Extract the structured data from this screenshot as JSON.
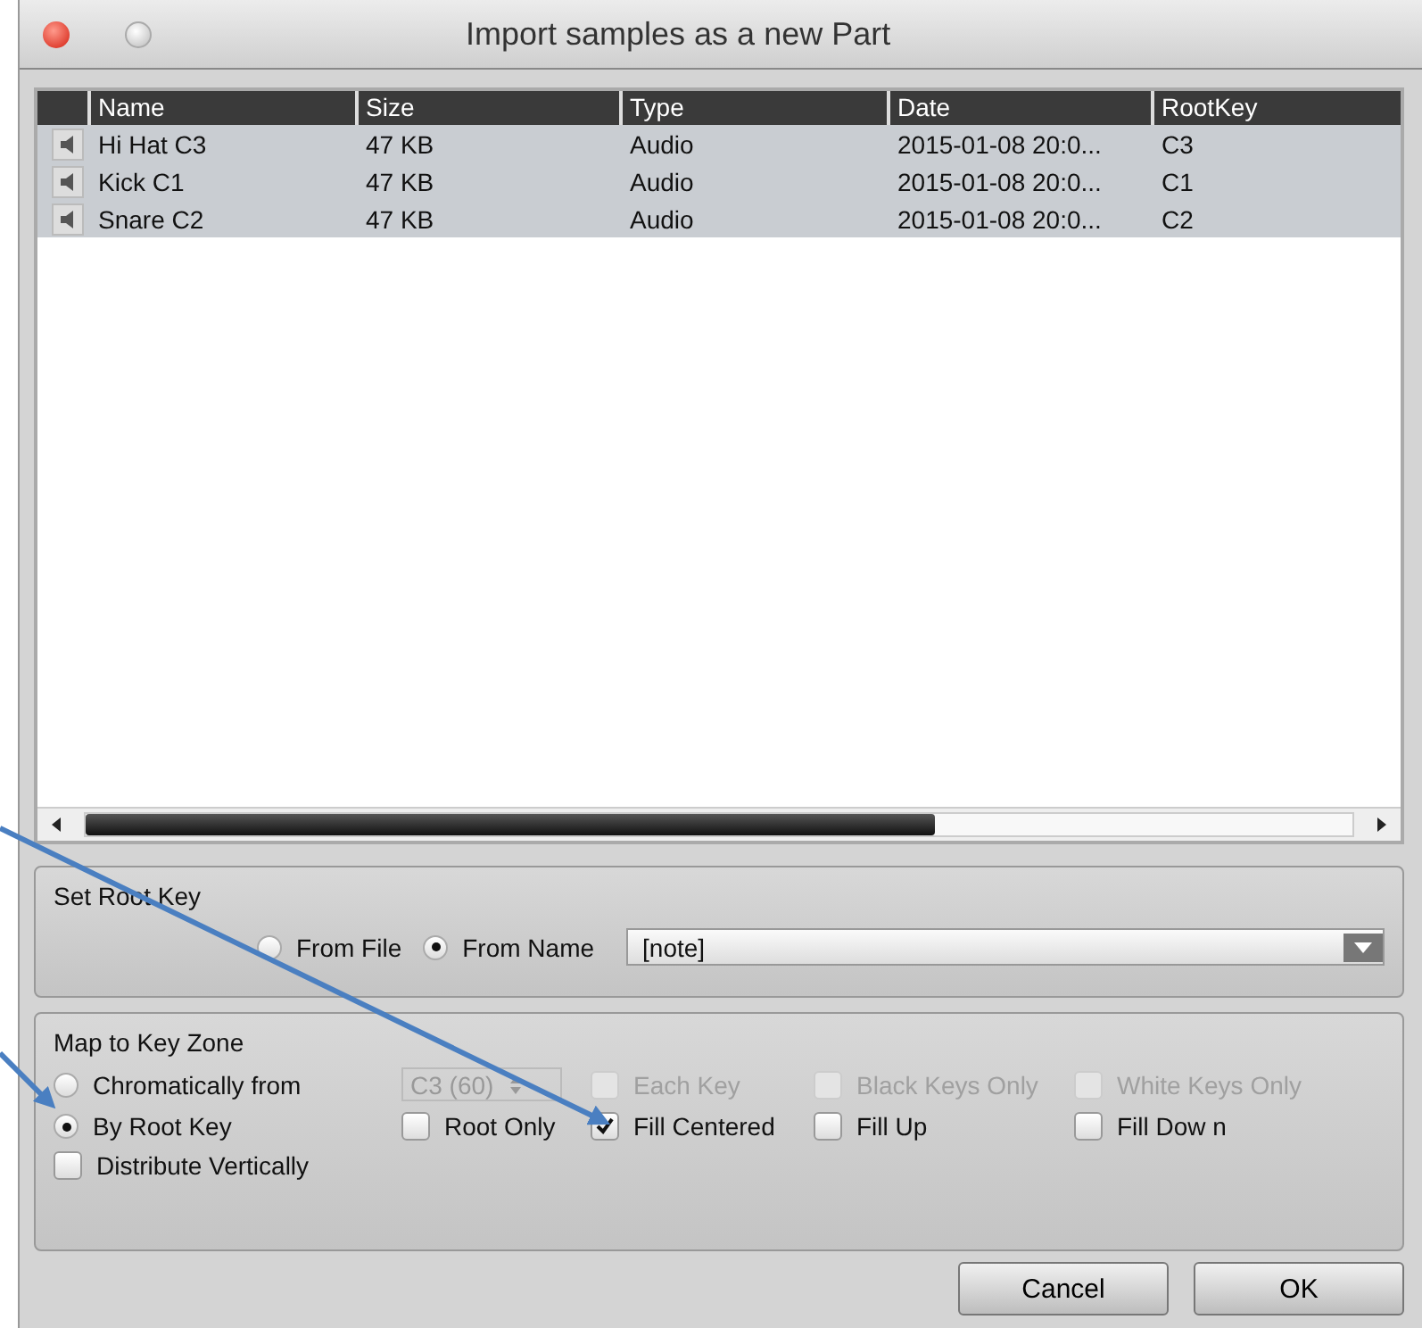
{
  "window": {
    "title": "Import samples as a new Part"
  },
  "table": {
    "columns": [
      "Name",
      "Size",
      "Type",
      "Date",
      "RootKey"
    ],
    "rows": [
      {
        "name": "Hi Hat C3",
        "size": "47 KB",
        "type": "Audio",
        "date": "2015-01-08 20:0...",
        "root_key": "C3",
        "selected": true
      },
      {
        "name": "Kick C1",
        "size": "47 KB",
        "type": "Audio",
        "date": "2015-01-08 20:0...",
        "root_key": "C1",
        "selected": true
      },
      {
        "name": "Snare C2",
        "size": "47 KB",
        "type": "Audio",
        "date": "2015-01-08 20:0...",
        "root_key": "C2",
        "selected": true
      }
    ]
  },
  "root_key": {
    "label": "Set Root Key",
    "sources": [
      {
        "label": "From File",
        "selected": false
      },
      {
        "label": "From Name",
        "selected": true
      }
    ],
    "pattern": "[note]"
  },
  "key_zone": {
    "label": "Map to Key Zone",
    "modes": [
      {
        "label": "Chromatically from",
        "selected": false
      },
      {
        "label": "By Root Key",
        "selected": true
      }
    ],
    "start_note": {
      "value": "C3 (60)",
      "disabled": true
    },
    "options": [
      {
        "label": "Each Key",
        "checked": false,
        "disabled": true
      },
      {
        "label": "Black Keys Only",
        "checked": false,
        "disabled": true
      },
      {
        "label": "White Keys Only",
        "checked": false,
        "disabled": true
      },
      {
        "label": "Root Only",
        "checked": false,
        "disabled": false
      },
      {
        "label": "Fill Centered",
        "checked": true,
        "disabled": false
      },
      {
        "label": "Fill Up",
        "checked": false,
        "disabled": false
      },
      {
        "label": "Fill Dow n",
        "checked": false,
        "disabled": false
      }
    ],
    "distribute": {
      "label": "Distribute Vertically",
      "checked": false
    }
  },
  "buttons": [
    "Cancel",
    "OK"
  ]
}
